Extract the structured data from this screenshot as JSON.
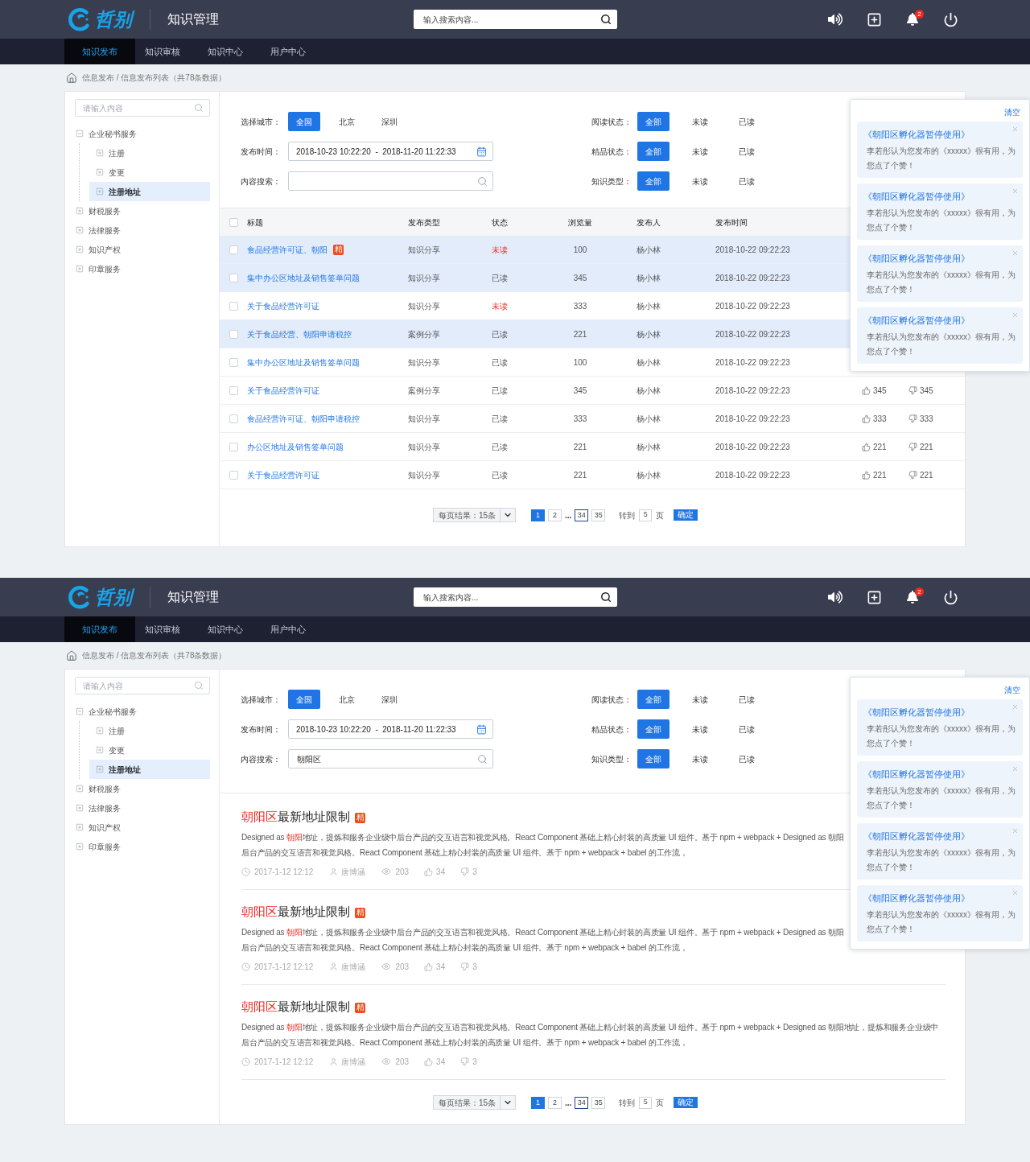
{
  "screens": [
    {
      "header": {
        "brand": "哲别",
        "title": "知识管理",
        "search": {
          "placeholder": "输入搜索内容..."
        },
        "badge": "2"
      },
      "nav": [
        {
          "label": "知识发布",
          "selected": true
        },
        {
          "label": "知识审核",
          "selected": false
        },
        {
          "label": "知识中心",
          "selected": false
        },
        {
          "label": "用户中心",
          "selected": false
        }
      ],
      "breadcrumb": "信息发布 / 信息发布列表（共78条数据）",
      "sidebar": {
        "search": {
          "placeholder": "请输入内容"
        },
        "tree": [
          {
            "label": "企业秘书服务",
            "expanded": true,
            "selected": false,
            "children": [
              {
                "label": "注册",
                "expanded": false,
                "selected": false
              },
              {
                "label": "变更",
                "expanded": false,
                "selected": false
              },
              {
                "label": "注册地址",
                "expanded": false,
                "selected": true
              }
            ]
          },
          {
            "label": "财税服务",
            "expanded": false,
            "selected": false
          },
          {
            "label": "法律服务",
            "expanded": false,
            "selected": false
          },
          {
            "label": "知识产权",
            "expanded": false,
            "selected": false
          },
          {
            "label": "印章服务",
            "expanded": false,
            "selected": false
          }
        ]
      },
      "filters": {
        "left": [
          {
            "kind": "options",
            "label": "选择城市：",
            "options": [
              {
                "label": "全国",
                "selected": true
              },
              {
                "label": "北京",
                "selected": false
              },
              {
                "label": "深圳",
                "selected": false
              }
            ]
          },
          {
            "kind": "date_range",
            "label": "发布时间：",
            "value": "2018-10-23 10:22:20  -  2018-11-20 11:22:33"
          },
          {
            "kind": "search",
            "label": "内容搜索："
          }
        ],
        "right": [
          {
            "kind": "options",
            "label": "阅读状态：",
            "options": [
              {
                "label": "全部",
                "selected": true
              },
              {
                "label": "未读",
                "selected": false
              },
              {
                "label": "已读",
                "selected": false
              }
            ]
          },
          {
            "kind": "options",
            "label": "精品状态：",
            "options": [
              {
                "label": "全部",
                "selected": true
              },
              {
                "label": "未读",
                "selected": false
              },
              {
                "label": "已读",
                "selected": false
              }
            ]
          },
          {
            "kind": "options",
            "label": "知识类型：",
            "options": [
              {
                "label": "全部",
                "selected": true
              },
              {
                "label": "未读",
                "selected": false
              },
              {
                "label": "已读",
                "selected": false
              }
            ]
          }
        ]
      },
      "content": {
        "kind": "table",
        "select_all": {
          "checked": false
        },
        "columns": [
          "标题",
          "发布类型",
          "状态",
          "浏览量",
          "发布人",
          "发布时间"
        ],
        "rows": [
          {
            "checked": false,
            "highlighted": true,
            "title": "食品经营许可证、朝阳",
            "badge": "精",
            "type": "知识分享",
            "status": "未读",
            "unread": true,
            "views": "100",
            "publisher": "杨小林",
            "time": "2018-10-22 09:22:23"
          },
          {
            "checked": false,
            "highlighted": true,
            "title": "集中办公区地址及销售签单问题",
            "type": "知识分享",
            "status": "已读",
            "unread": false,
            "views": "345",
            "publisher": "杨小林",
            "time": "2018-10-22 09:22:23"
          },
          {
            "checked": false,
            "highlighted": false,
            "title": "关于食品经营许可证",
            "type": "知识分享",
            "status": "未读",
            "unread": true,
            "views": "333",
            "publisher": "杨小林",
            "time": "2018-10-22 09:22:23"
          },
          {
            "checked": false,
            "highlighted": true,
            "title": "关于食品经营、朝阳申请税控",
            "type": "案例分享",
            "status": "已读",
            "unread": false,
            "views": "221",
            "publisher": "杨小林",
            "time": "2018-10-22 09:22:23"
          },
          {
            "checked": false,
            "highlighted": false,
            "title": "集中办公区地址及销售签单问题",
            "type": "知识分享",
            "status": "已读",
            "unread": false,
            "views": "100",
            "publisher": "杨小林",
            "time": "2018-10-22 09:22:23"
          },
          {
            "checked": false,
            "highlighted": false,
            "title": "关于食品经营许可证",
            "type": "案例分享",
            "status": "已读",
            "unread": false,
            "views": "345",
            "publisher": "杨小林",
            "time": "2018-10-22 09:22:23",
            "likes": "345",
            "dislikes": "345"
          },
          {
            "checked": false,
            "highlighted": false,
            "title": "食品经营许可证、朝阳申请税控",
            "type": "知识分享",
            "status": "已读",
            "unread": false,
            "views": "333",
            "publisher": "杨小林",
            "time": "2018-10-22 09:22:23",
            "likes": "333",
            "dislikes": "333"
          },
          {
            "checked": false,
            "highlighted": false,
            "title": "办公区地址及销售签单问题",
            "type": "知识分享",
            "status": "已读",
            "unread": false,
            "views": "221",
            "publisher": "杨小林",
            "time": "2018-10-22 09:22:23",
            "likes": "221",
            "dislikes": "221"
          },
          {
            "checked": false,
            "highlighted": false,
            "title": "关于食品经营许可证",
            "type": "知识分享",
            "status": "已读",
            "unread": false,
            "views": "221",
            "publisher": "杨小林",
            "time": "2018-10-22 09:22:23",
            "likes": "221",
            "dislikes": "221"
          }
        ]
      },
      "pagination": {
        "page_size": "每页结果：15条",
        "pages": [
          {
            "kind": "page",
            "label": "1",
            "selected": true,
            "hovered": false
          },
          {
            "kind": "page",
            "label": "2",
            "selected": false,
            "hovered": false
          },
          {
            "kind": "ellipsis",
            "label": "..."
          },
          {
            "kind": "page",
            "label": "34",
            "selected": false,
            "hovered": true
          },
          {
            "kind": "page",
            "label": "35",
            "selected": false,
            "hovered": false
          }
        ],
        "goto_label": "转到",
        "goto_value": "5",
        "goto_unit": "页",
        "confirm": "确定"
      },
      "notifications": {
        "clear": "清空",
        "items": [
          {
            "title": "《朝阳区孵化器暂停使用》",
            "message": "李若彤认为您发布的《xxxxx》很有用，为您点了个赞！"
          },
          {
            "title": "《朝阳区孵化器暂停使用》",
            "message": "李若彤认为您发布的《xxxxx》很有用，为您点了个赞！"
          },
          {
            "title": "《朝阳区孵化器暂停使用》",
            "message": "李若彤认为您发布的《xxxxx》很有用，为您点了个赞！"
          },
          {
            "title": "《朝阳区孵化器暂停使用》",
            "message": "李若彤认为您发布的《xxxxx》很有用，为您点了个赞！"
          }
        ]
      }
    },
    {
      "header": {
        "brand": "哲别",
        "title": "知识管理",
        "search": {
          "placeholder": "输入搜索内容..."
        },
        "badge": "2"
      },
      "nav": [
        {
          "label": "知识发布",
          "selected": true
        },
        {
          "label": "知识审核",
          "selected": false
        },
        {
          "label": "知识中心",
          "selected": false
        },
        {
          "label": "用户中心",
          "selected": false
        }
      ],
      "breadcrumb": "信息发布 / 信息发布列表（共78条数据）",
      "sidebar": {
        "search": {
          "placeholder": "请输入内容"
        },
        "tree": [
          {
            "label": "企业秘书服务",
            "expanded": true,
            "selected": false,
            "children": [
              {
                "label": "注册",
                "expanded": false,
                "selected": false
              },
              {
                "label": "变更",
                "expanded": false,
                "selected": false
              },
              {
                "label": "注册地址",
                "expanded": false,
                "selected": true
              }
            ]
          },
          {
            "label": "财税服务",
            "expanded": false,
            "selected": false
          },
          {
            "label": "法律服务",
            "expanded": false,
            "selected": false
          },
          {
            "label": "知识产权",
            "expanded": false,
            "selected": false
          },
          {
            "label": "印章服务",
            "expanded": false,
            "selected": false
          }
        ]
      },
      "filters": {
        "left": [
          {
            "kind": "options",
            "label": "选择城市：",
            "options": [
              {
                "label": "全国",
                "selected": true
              },
              {
                "label": "北京",
                "selected": false
              },
              {
                "label": "深圳",
                "selected": false
              }
            ]
          },
          {
            "kind": "date_range",
            "label": "发布时间：",
            "value": "2018-10-23 10:22:20  -  2018-11-20 11:22:33"
          },
          {
            "kind": "search",
            "label": "内容搜索：",
            "value": "朝阳区"
          }
        ],
        "right": [
          {
            "kind": "options",
            "label": "阅读状态：",
            "options": [
              {
                "label": "全部",
                "selected": true
              },
              {
                "label": "未读",
                "selected": false
              },
              {
                "label": "已读",
                "selected": false
              }
            ]
          },
          {
            "kind": "options",
            "label": "精品状态：",
            "options": [
              {
                "label": "全部",
                "selected": true
              },
              {
                "label": "未读",
                "selected": false
              },
              {
                "label": "已读",
                "selected": false
              }
            ]
          },
          {
            "kind": "options",
            "label": "知识类型：",
            "options": [
              {
                "label": "全部",
                "selected": true
              },
              {
                "label": "未读",
                "selected": false
              },
              {
                "label": "已读",
                "selected": false
              }
            ]
          }
        ]
      },
      "content": {
        "kind": "list",
        "items": [
          {
            "title": [
              {
                "text": "朝阳区",
                "highlight": true
              },
              {
                "text": "最新地址限制",
                "highlight": false
              }
            ],
            "badge": "精",
            "excerpt": [
              [
                {
                  "text": "Designed as ",
                  "highlight": false
                },
                {
                  "text": "朝阳",
                  "highlight": true
                },
                {
                  "text": "地址，提炼和服务企业级中后台产品的交互语言和视觉风格。React Component 基础上精心封装的高质量 UI 组件。基于 npm + webpack + Designed as 朝阳",
                  "highlight": false
                }
              ],
              [
                {
                  "text": "后台产品的交互语言和视觉风格。React Component 基础上精心封装的高质量 UI 组件。基于 npm + webpack + babel 的工作流，",
                  "highlight": false
                }
              ]
            ],
            "meta": {
              "date": "2017-1-12 12:12",
              "author": "唐博涵",
              "views": "203",
              "likes": "34",
              "dislikes": "3"
            }
          },
          {
            "title": [
              {
                "text": "朝阳区",
                "highlight": true
              },
              {
                "text": "最新地址限制",
                "highlight": false
              }
            ],
            "badge": "精",
            "excerpt": [
              [
                {
                  "text": "Designed as ",
                  "highlight": false
                },
                {
                  "text": "朝阳",
                  "highlight": true
                },
                {
                  "text": "地址，提炼和服务企业级中后台产品的交互语言和视觉风格。React Component 基础上精心封装的高质量 UI 组件。基于 npm + webpack + Designed as 朝阳",
                  "highlight": false
                }
              ],
              [
                {
                  "text": "后台产品的交互语言和视觉风格。React Component 基础上精心封装的高质量 UI 组件。基于 npm + webpack + babel 的工作流，",
                  "highlight": false
                }
              ]
            ],
            "meta": {
              "date": "2017-1-12 12:12",
              "author": "唐博涵",
              "views": "203",
              "likes": "34",
              "dislikes": "3"
            }
          },
          {
            "title": [
              {
                "text": "朝阳区",
                "highlight": true
              },
              {
                "text": "最新地址限制",
                "highlight": false
              }
            ],
            "badge": "精",
            "excerpt": [
              [
                {
                  "text": "Designed as ",
                  "highlight": false
                },
                {
                  "text": "朝阳",
                  "highlight": true
                },
                {
                  "text": "地址，提炼和服务企业级中后台产品的交互语言和视觉风格。React Component 基础上精心封装的高质量 UI 组件。基于 npm + webpack + Designed as 朝阳地址，提炼和服务企业级中",
                  "highlight": false
                }
              ],
              [
                {
                  "text": "后台产品的交互语言和视觉风格。React Component 基础上精心封装的高质量 UI 组件。基于 npm + webpack + babel 的工作流，",
                  "highlight": false
                }
              ]
            ],
            "meta": {
              "date": "2017-1-12 12:12",
              "author": "唐博涵",
              "views": "203",
              "likes": "34",
              "dislikes": "3"
            }
          }
        ]
      },
      "pagination": {
        "page_size": "每页结果：15条",
        "pages": [
          {
            "kind": "page",
            "label": "1",
            "selected": true,
            "hovered": false
          },
          {
            "kind": "page",
            "label": "2",
            "selected": false,
            "hovered": false
          },
          {
            "kind": "ellipsis",
            "label": "..."
          },
          {
            "kind": "page",
            "label": "34",
            "selected": false,
            "hovered": true
          },
          {
            "kind": "page",
            "label": "35",
            "selected": false,
            "hovered": false
          }
        ],
        "goto_label": "转到",
        "goto_value": "5",
        "goto_unit": "页",
        "confirm": "确定"
      },
      "notifications": {
        "clear": "清空",
        "items": [
          {
            "title": "《朝阳区孵化器暂停使用》",
            "message": "李若彤认为您发布的《xxxxx》很有用，为您点了个赞！"
          },
          {
            "title": "《朝阳区孵化器暂停使用》",
            "message": "李若彤认为您发布的《xxxxx》很有用，为您点了个赞！"
          },
          {
            "title": "《朝阳区孵化器暂停使用》",
            "message": "李若彤认为您发布的《xxxxx》很有用，为您点了个赞！"
          },
          {
            "title": "《朝阳区孵化器暂停使用》",
            "message": "李若彤认为您发布的《xxxxx》很有用，为您点了个赞！"
          }
        ]
      }
    }
  ]
}
